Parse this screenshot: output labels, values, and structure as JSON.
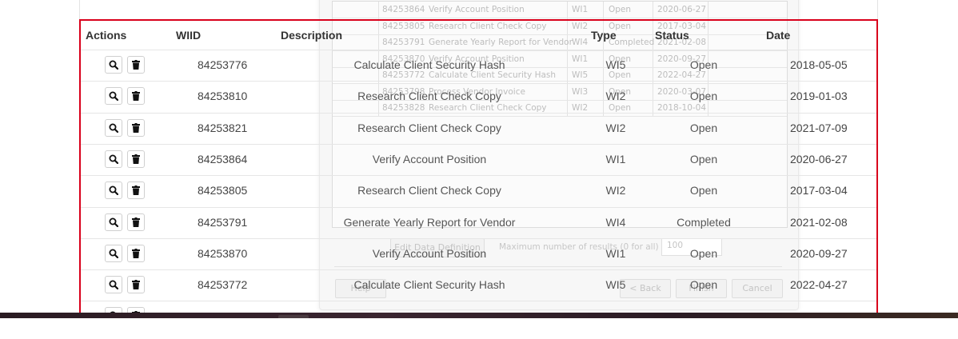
{
  "table": {
    "headers": {
      "actions": "Actions",
      "wiid": "WIID",
      "description": "Description",
      "type": "Type",
      "status": "Status",
      "date": "Date"
    },
    "rows": [
      {
        "wiid": "84253776",
        "description": "Calculate Client Security Hash",
        "type": "WI5",
        "status": "Open",
        "date": "2018-05-05"
      },
      {
        "wiid": "84253810",
        "description": "Research Client Check Copy",
        "type": "WI2",
        "status": "Open",
        "date": "2019-01-03"
      },
      {
        "wiid": "84253821",
        "description": "Research Client Check Copy",
        "type": "WI2",
        "status": "Open",
        "date": "2021-07-09"
      },
      {
        "wiid": "84253864",
        "description": "Verify Account Position",
        "type": "WI1",
        "status": "Open",
        "date": "2020-06-27"
      },
      {
        "wiid": "84253805",
        "description": "Research Client Check Copy",
        "type": "WI2",
        "status": "Open",
        "date": "2017-03-04"
      },
      {
        "wiid": "84253791",
        "description": "Generate Yearly Report for Vendor",
        "type": "WI4",
        "status": "Completed",
        "date": "2021-02-08"
      },
      {
        "wiid": "84253870",
        "description": "Verify Account Position",
        "type": "WI1",
        "status": "Open",
        "date": "2020-09-27"
      },
      {
        "wiid": "84253772",
        "description": "Calculate Client Security Hash",
        "type": "WI5",
        "status": "Open",
        "date": "2022-04-27"
      }
    ],
    "icons": {
      "view": "search-icon",
      "delete": "trash-icon"
    }
  },
  "background_dialog": {
    "rows": [
      {
        "wiid": "84253864",
        "description": "Verify Account Position",
        "type": "WI1",
        "status": "Open",
        "date": "2020-06-27"
      },
      {
        "wiid": "84253805",
        "description": "Research Client Check Copy",
        "type": "WI2",
        "status": "Open",
        "date": "2017-03-04"
      },
      {
        "wiid": "84253791",
        "description": "Generate Yearly Report for Vendor",
        "type": "WI4",
        "status": "Completed",
        "date": "2021-02-08"
      },
      {
        "wiid": "84253870",
        "description": "Verify Account Position",
        "type": "WI1",
        "status": "Open",
        "date": "2020-09-27"
      },
      {
        "wiid": "84253772",
        "description": "Calculate Client Security Hash",
        "type": "WI5",
        "status": "Open",
        "date": "2022-04-27"
      },
      {
        "wiid": "84253798",
        "description": "Process Vendor Invoice",
        "type": "WI3",
        "status": "Open",
        "date": "2020-03-07"
      },
      {
        "wiid": "84253828",
        "description": "Research Client Check Copy",
        "type": "WI2",
        "status": "Open",
        "date": "2018-10-04"
      }
    ],
    "edit_data_definition": "Edit Data Definition",
    "max_results_label": "Maximum number of results (0 for all)",
    "max_results_value": "100",
    "help": "Help",
    "back": "< Back",
    "finish": "Finish",
    "cancel": "Cancel"
  },
  "colors": {
    "selection_outline": "#d9001b",
    "taskbar": "#2a1b22"
  }
}
